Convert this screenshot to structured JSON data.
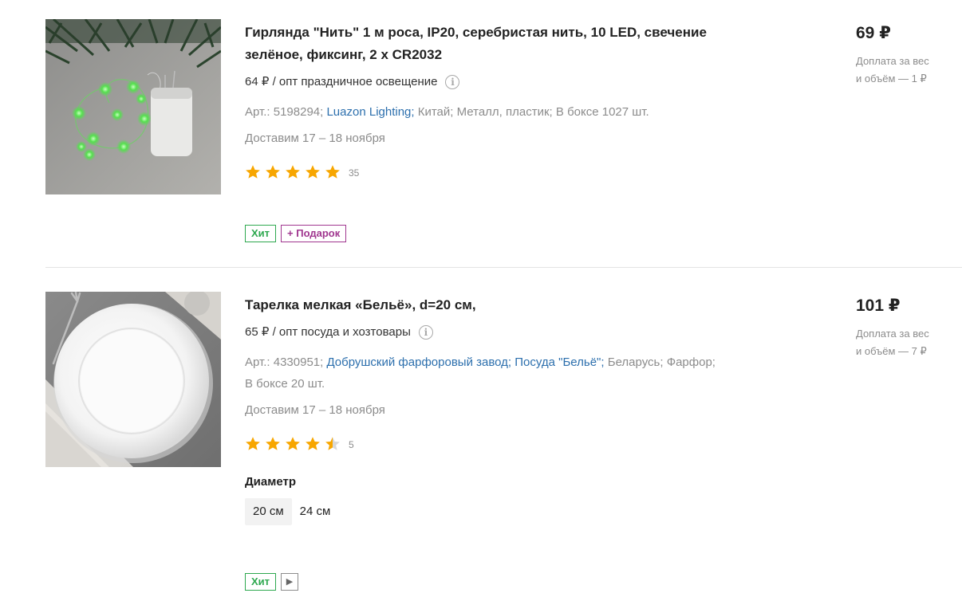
{
  "products": [
    {
      "title_line1": "Гирлянда \"Нить\" 1 м роса, IP20, серебристая нить, 10 LED, свечение",
      "title_line2": "зелёное, фиксинг, 2 х CR2032",
      "opt_price": "64 ₽ / опт праздничное освещение",
      "info_icon": "i",
      "art": "Арт.: 5198294;",
      "brand": "Luazon Lighting;",
      "country": "Китай;",
      "material": "Металл, пластик;",
      "box": "В боксе 1027 шт.",
      "delivery": "Доставим 17 – 18 ноября",
      "rating": 5,
      "review_count": "35",
      "badges": {
        "hit": "Хит",
        "gift": "+ Подарок"
      },
      "price": "69 ₽",
      "surcharge_line1": "Доплата за вес",
      "surcharge_line2": "и объём — 1 ₽"
    },
    {
      "title": "Тарелка мелкая «Бельё», d=20 см,",
      "opt_price": "65 ₽ / опт посуда и хозтовары",
      "info_icon": "i",
      "art": "Арт.: 4330951;",
      "brand": "Добрушский фарфоровый завод;",
      "series": "Посуда \"Бельё\";",
      "country": "Беларусь;",
      "material": "Фарфор;",
      "box": "В боксе 20 шт.",
      "delivery": "Доставим 17 – 18 ноября",
      "rating": 4.5,
      "review_count": "5",
      "variant_label": "Диаметр",
      "variants": [
        "20 см",
        "24 см"
      ],
      "selected_variant": "20 см",
      "badges": {
        "hit": "Хит",
        "video": "▶"
      },
      "price": "101 ₽",
      "surcharge_line1": "Доплата за вес",
      "surcharge_line2": "и объём — 7 ₽"
    }
  ],
  "colors": {
    "star": "#f7a600",
    "star_empty": "#d8d8d8",
    "link": "#2c6fad",
    "hit": "#2ea84f",
    "gift": "#a0368f"
  },
  "icons": [
    "info-icon",
    "star-icon",
    "play-icon"
  ]
}
